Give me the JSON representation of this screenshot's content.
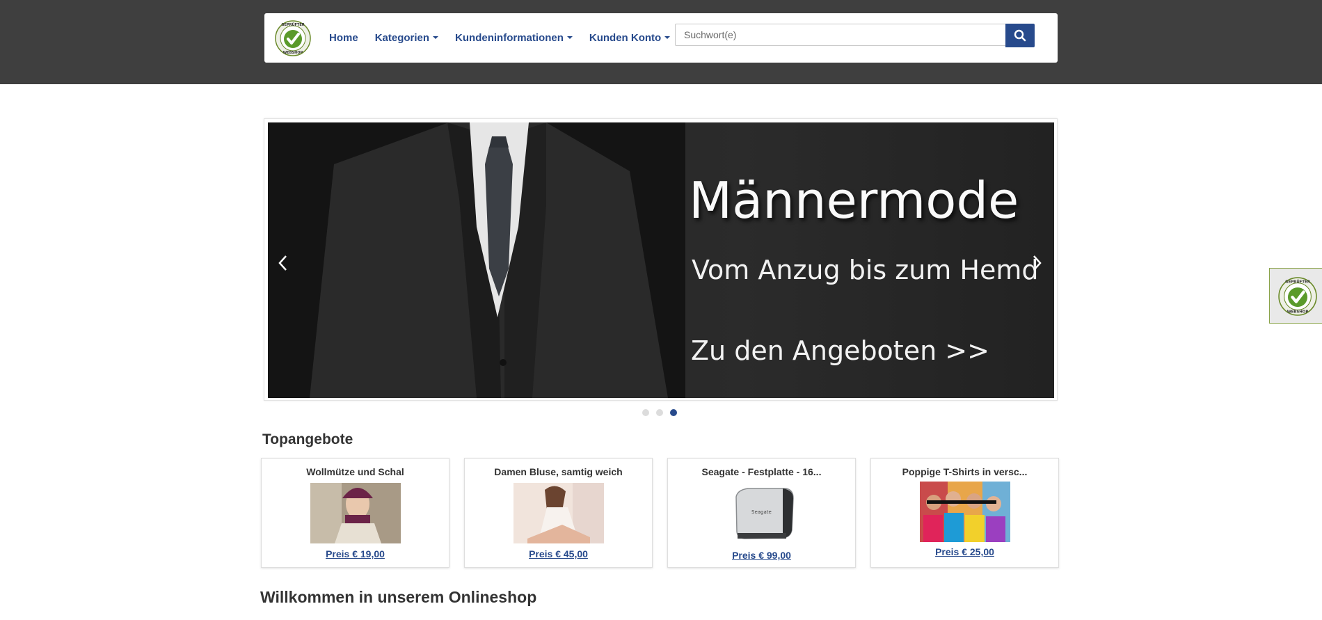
{
  "logo": {
    "text_top": "GEPRÜFTER",
    "text_bottom": "WEBSHOP"
  },
  "nav": {
    "home": "Home",
    "kategorien": "Kategorien",
    "kundeninfo": "Kundeninformationen",
    "konto": "Kunden Konto"
  },
  "search": {
    "placeholder": "Suchwort(e)"
  },
  "carousel": {
    "title": "Männermode",
    "subtitle": "Vom Anzug bis zum Hemd",
    "cta": "Zu den Angeboten >>",
    "active_slide": 3,
    "slide_count": 3
  },
  "topangebote": {
    "heading": "Topangebote",
    "items": [
      {
        "title": "Wollmütze und Schal",
        "price": "Preis € 19,00"
      },
      {
        "title": "Damen Bluse, samtig weich",
        "price": "Preis € 45,00"
      },
      {
        "title": "Seagate - Festplatte - 16...",
        "price": "Preis € 99,00"
      },
      {
        "title": "Poppige T-Shirts in versc...",
        "price": "Preis € 25,00"
      }
    ]
  },
  "welcome": {
    "heading": "Willkommen in unserem Onlineshop"
  },
  "colors": {
    "brand": "#274a8c",
    "header_bg": "#3f3f3f",
    "seal_green": "#5a9a2a"
  }
}
